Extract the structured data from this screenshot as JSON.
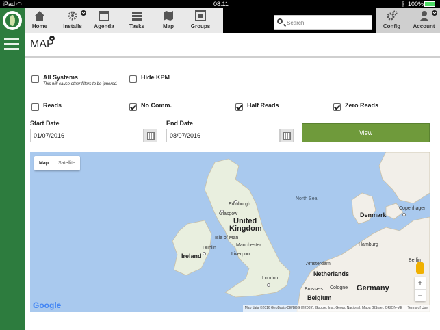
{
  "status_bar": {
    "device": "iPad",
    "time": "08:11",
    "battery": "100%"
  },
  "nav": {
    "items": [
      {
        "label": "Home",
        "icon": "home-icon"
      },
      {
        "label": "Installs",
        "icon": "gear-icon"
      },
      {
        "label": "Agenda",
        "icon": "calendar-icon"
      },
      {
        "label": "Tasks",
        "icon": "tasks-icon"
      },
      {
        "label": "Map",
        "icon": "map-icon"
      },
      {
        "label": "Groups",
        "icon": "groups-icon"
      },
      {
        "label": "Config",
        "icon": "config-icon"
      },
      {
        "label": "Account",
        "icon": "account-icon"
      }
    ],
    "search_placeholder": "Search"
  },
  "page": {
    "title": "MAP"
  },
  "filters": {
    "all_systems": {
      "label": "All Systems",
      "note": "This will cause other filters to be ignored.",
      "checked": false
    },
    "hide_kpm": {
      "label": "Hide KPM",
      "checked": false
    },
    "reads": {
      "label": "Reads",
      "checked": false
    },
    "no_comm": {
      "label": "No Comm.",
      "checked": true
    },
    "half_reads": {
      "label": "Half Reads",
      "checked": true
    },
    "zero_reads": {
      "label": "Zero Reads",
      "checked": true
    }
  },
  "dates": {
    "start_label": "Start Date",
    "start_value": "01/07/2016",
    "end_label": "End Date",
    "end_value": "08/07/2016"
  },
  "view_button": "View",
  "map": {
    "toggle_map": "Map",
    "toggle_satellite": "Satellite",
    "labels": {
      "edinburgh": "Edinburgh",
      "glasgow": "Glasgow",
      "uk1": "United",
      "uk2": "Kingdom",
      "isle_of_man": "Isle of Man",
      "dublin": "Dublin",
      "ireland": "Ireland",
      "manchester": "Manchester",
      "liverpool": "Liverpool",
      "london": "London",
      "north_sea": "North Sea",
      "copenhagen": "Copenhagen",
      "denmark": "Denmark",
      "hamburg": "Hamburg",
      "amsterdam": "Amsterdam",
      "netherlands": "Netherlands",
      "cologne": "Cologne",
      "belgium": "Belgium",
      "germany": "Germany",
      "berlin": "Berlin",
      "brussels": "Brussels"
    },
    "google": "Google",
    "attribution": "Map data ©2016 GeoBasis-DE/BKG (©2009), Google, Inst. Geogr. Nacional, Mapa GISrael, ORION-ME",
    "terms": "Terms of Use",
    "zoom_in": "+",
    "zoom_out": "−"
  },
  "colors": {
    "brand_green": "#2d7c3e",
    "button_green": "#6f9a3b",
    "water": "#a9c9ee",
    "land": "#f2efe9"
  }
}
